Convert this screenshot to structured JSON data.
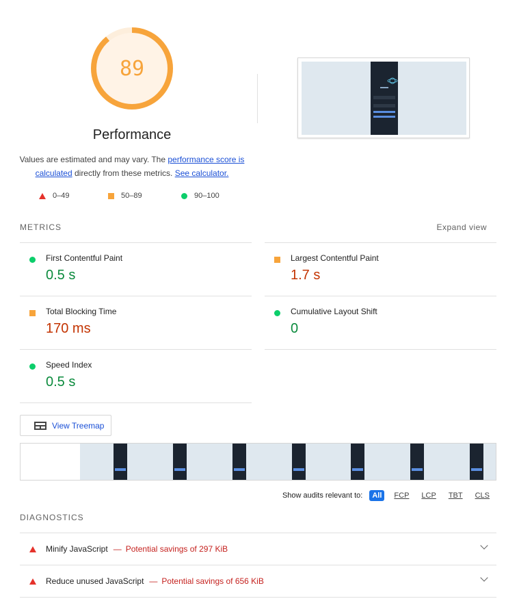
{
  "score": {
    "value": "89",
    "fraction": 0.89,
    "title": "Performance",
    "color": "#f7a43b"
  },
  "description": {
    "prefix": "Values are estimated and may vary. The ",
    "link1": "performance score is calculated",
    "middle": " directly from these metrics. ",
    "link2": "See calculator."
  },
  "legend": [
    {
      "icon": "red-triangle-icon",
      "range": "0–49"
    },
    {
      "icon": "orange-square-icon",
      "range": "50–89"
    },
    {
      "icon": "green-circle-icon",
      "range": "90–100"
    }
  ],
  "metrics": {
    "header": "METRICS",
    "expand_label": "Expand view",
    "items": [
      {
        "label": "First Contentful Paint",
        "value": "0.5 s",
        "status": "pass"
      },
      {
        "label": "Largest Contentful Paint",
        "value": "1.7 s",
        "status": "average"
      },
      {
        "label": "Total Blocking Time",
        "value": "170 ms",
        "status": "average"
      },
      {
        "label": "Cumulative Layout Shift",
        "value": "0",
        "status": "pass"
      },
      {
        "label": "Speed Index",
        "value": "0.5 s",
        "status": "pass"
      }
    ]
  },
  "treemap_button": "View Treemap",
  "audit_filter": {
    "label": "Show audits relevant to:",
    "options": [
      "All",
      "FCP",
      "LCP",
      "TBT",
      "CLS"
    ],
    "selected": "All"
  },
  "diagnostics": {
    "header": "DIAGNOSTICS",
    "items": [
      {
        "title": "Minify JavaScript",
        "separator": "—",
        "savings": "Potential savings of 297 KiB"
      },
      {
        "title": "Reduce unused JavaScript",
        "separator": "—",
        "savings": "Potential savings of 656 KiB"
      }
    ]
  }
}
